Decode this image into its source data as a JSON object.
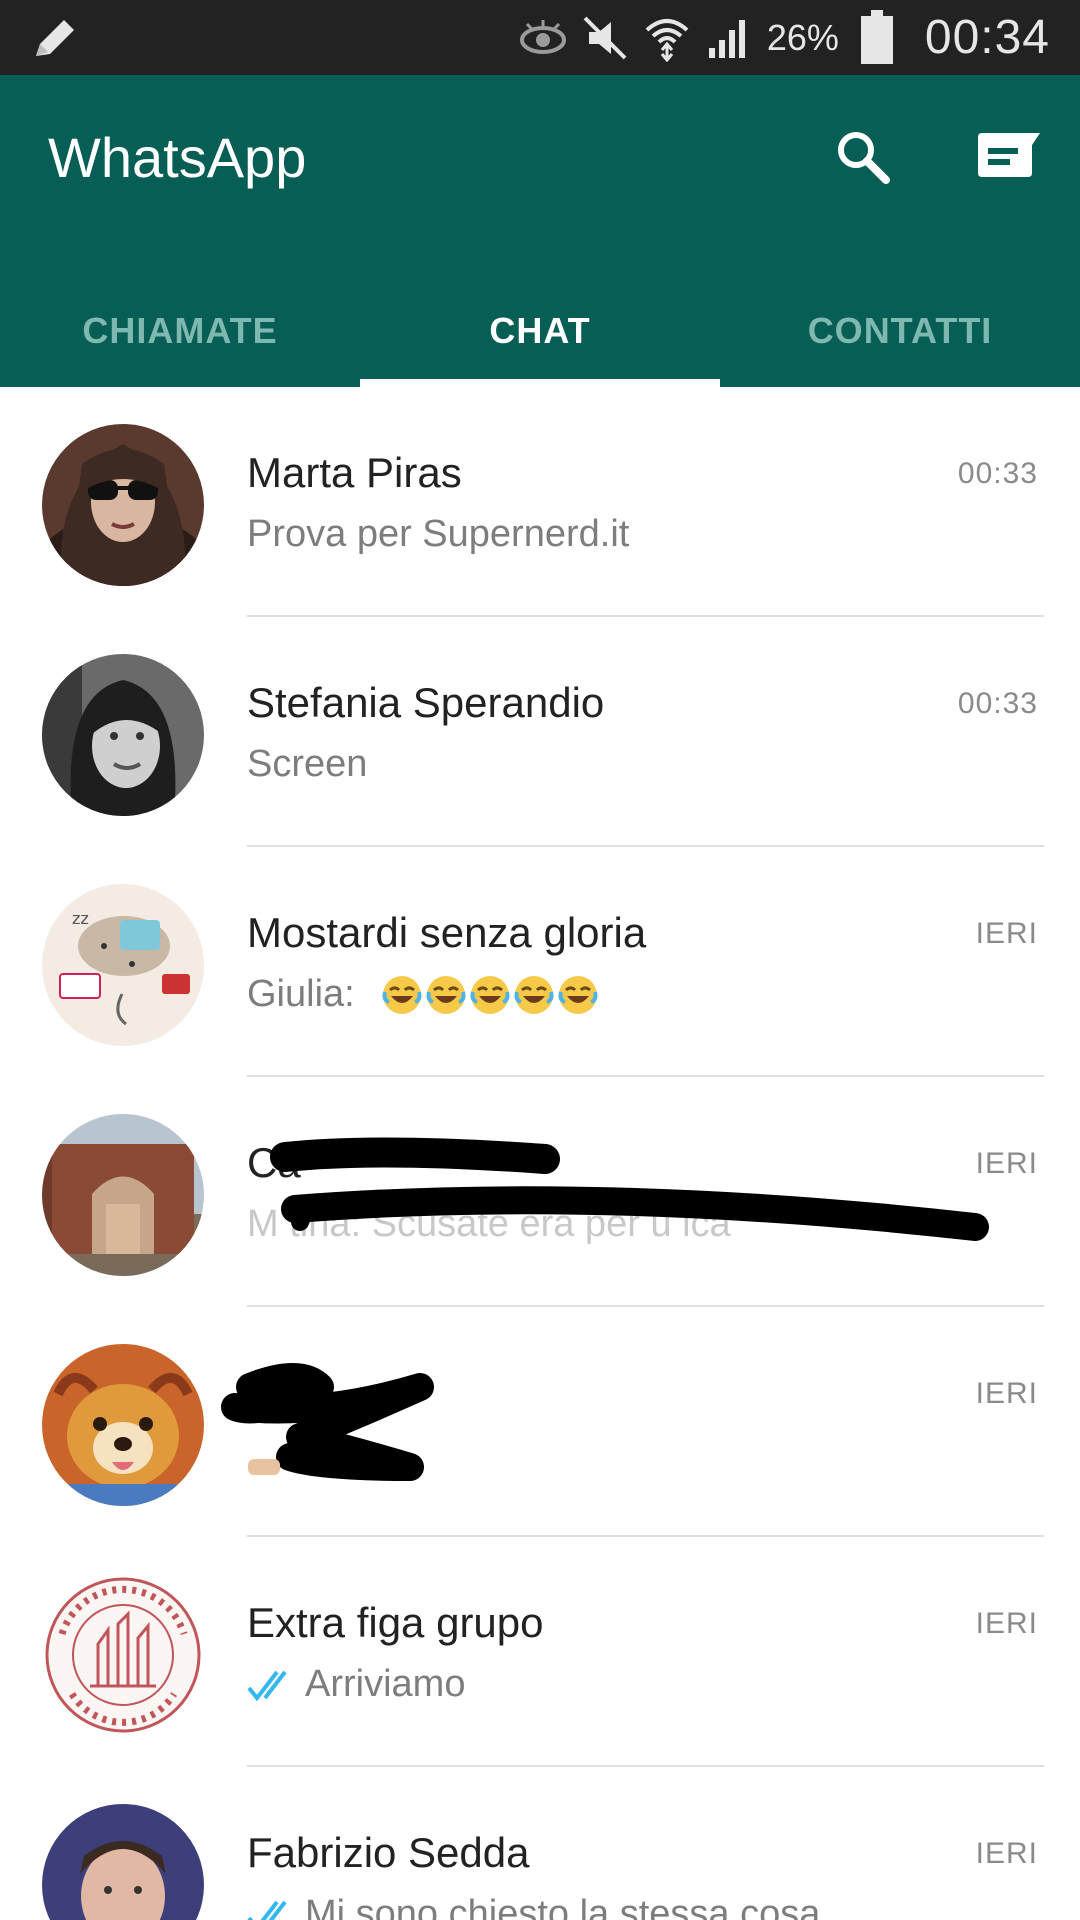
{
  "status_bar": {
    "battery_percent": "26%",
    "time": "00:34",
    "icons": [
      "edit-pencil-icon",
      "eye-icon",
      "mute-icon",
      "wifi-icon",
      "signal-icon",
      "battery-icon"
    ]
  },
  "app_bar": {
    "title": "WhatsApp",
    "search_icon": "search-icon",
    "compose_icon": "new-chat-icon",
    "color": "#075e54"
  },
  "tabs": [
    {
      "label": "CHIAMATE",
      "active": false
    },
    {
      "label": "CHAT",
      "active": true
    },
    {
      "label": "CONTATTI",
      "active": false
    }
  ],
  "chats": [
    {
      "name": "Marta Piras",
      "time": "00:33",
      "preview": "Prova per Supernerd.it",
      "sender": "",
      "read_ticks": false
    },
    {
      "name": "Stefania Sperandio",
      "time": "00:33",
      "preview": "Screen",
      "sender": "",
      "read_ticks": false
    },
    {
      "name": "Mostardi senza gloria",
      "time": "IERI",
      "preview": "",
      "sender": "Giulia:",
      "emoji_count": 5,
      "read_ticks": false
    },
    {
      "name": "Ca",
      "time": "IERI",
      "preview": "M    tina: Scusate era per u              ica",
      "sender": "",
      "read_ticks": false
    },
    {
      "name": "",
      "time": "IERI",
      "preview": "",
      "sender": "",
      "read_ticks": false
    },
    {
      "name": "Extra figa grupo",
      "time": "IERI",
      "preview": "Arriviamo",
      "sender": "",
      "read_ticks": true
    },
    {
      "name": "Fabrizio Sedda",
      "time": "IERI",
      "preview": "Mi sono chiesto la stessa cosa",
      "sender": "",
      "read_ticks": true
    }
  ],
  "colors": {
    "accent": "#075e54",
    "read_tick": "#34b7f1",
    "tab_inactive": "#7fb8b0"
  }
}
